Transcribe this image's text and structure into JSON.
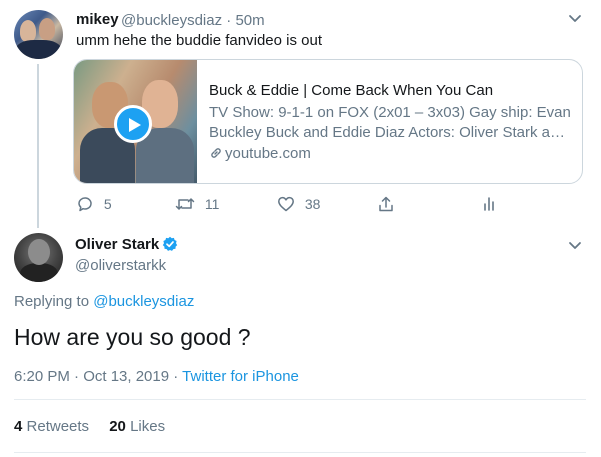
{
  "first_tweet": {
    "display_name": "mikey",
    "handle": "@buckleysdiaz",
    "time": "· 50m",
    "text": "umm hehe the buddie fanvideo is out",
    "card": {
      "title": "Buck & Eddie | Come Back When You Can",
      "description_line1": "TV Show: 9-1-1 on FOX (2x01 – 3x03) Gay ship: Evan",
      "description_line2": "Buckley Buck and Eddie Diaz Actors: Oliver Stark and ...",
      "domain": "youtube.com"
    },
    "actions": {
      "reply_count": "5",
      "retweet_count": "11",
      "like_count": "38"
    }
  },
  "main_tweet": {
    "display_name": "Oliver Stark",
    "handle": "@oliverstarkk",
    "replying_prefix": "Replying to ",
    "replying_to": "@buckleysdiaz",
    "text": "How are you so good ?",
    "timestamp": "6:20 PM · Oct 13, 2019 · ",
    "source": "Twitter for iPhone",
    "retweets_count": "4",
    "retweets_label": "Retweets",
    "likes_count": "20",
    "likes_label": "Likes"
  },
  "colors": {
    "link": "#1b95e0",
    "accent": "#1da1f2",
    "secondary_text": "#657786",
    "border": "#ccd6dd"
  }
}
